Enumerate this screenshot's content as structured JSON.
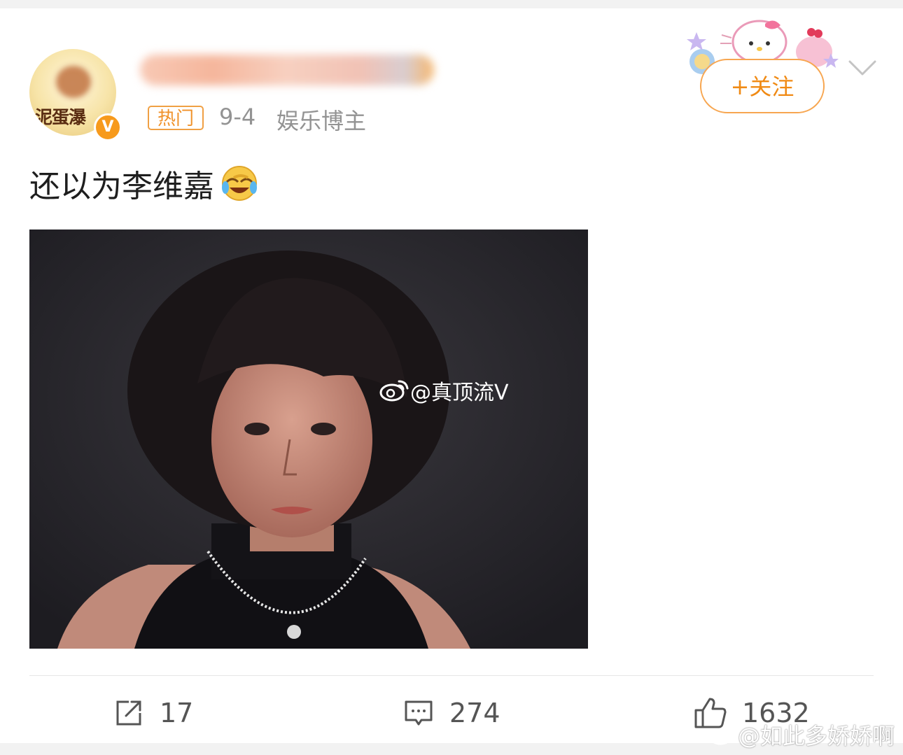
{
  "post": {
    "avatar_text": "泥蛋瀑",
    "verified_badge": "V",
    "hot_tag": "热门",
    "date": "9-4",
    "role": "娱乐博主",
    "follow_label": "+关注",
    "text": "还以为李维嘉",
    "emoji": "laughing-crying-emoji",
    "image": {
      "watermark": "@真顶流V",
      "watermark_icon": "weibo-logo-icon"
    }
  },
  "actions": {
    "share_count": "17",
    "comment_count": "274",
    "like_count": "1632"
  },
  "page_watermark": "@如此多娇娇啊",
  "colors": {
    "accent": "#f08a14",
    "hot_tag": "#f0922a",
    "meta_text": "#939393",
    "body_text": "#1e1e1e",
    "action_text": "#555555"
  }
}
